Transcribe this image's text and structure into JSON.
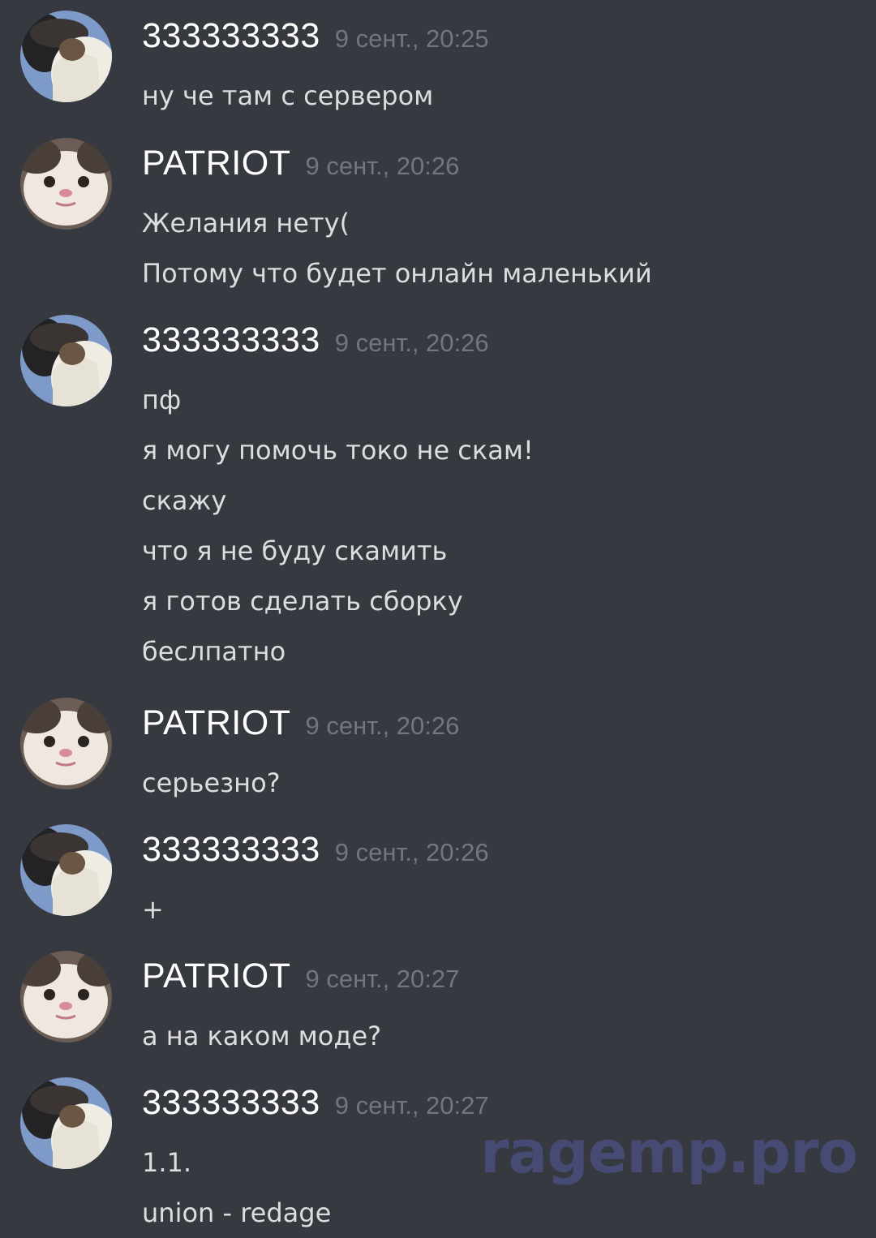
{
  "messages": [
    {
      "author": "333333333",
      "avatar": "hooded-avatar-icon",
      "time": "9 сент., 20:25",
      "lines": [
        "ну че там с сервером"
      ]
    },
    {
      "author": "PATRIOT",
      "avatar": "cat-avatar-icon",
      "time": "9 сент., 20:26",
      "lines": [
        "Желания нету(",
        "Потому что будет онлайн маленький"
      ]
    },
    {
      "author": "333333333",
      "avatar": "hooded-avatar-icon",
      "time": "9 сент., 20:26",
      "lines": [
        "пф",
        "я могу помочь токо не скам!",
        "скажу",
        "что я не буду скамить",
        "я готов сделать сборку",
        "беслпатно"
      ]
    },
    {
      "author": "PATRIOT",
      "avatar": "cat-avatar-icon",
      "time": "9 сент., 20:26",
      "lines": [
        "серьезно?"
      ]
    },
    {
      "author": "333333333",
      "avatar": "hooded-avatar-icon",
      "time": "9 сент., 20:26",
      "lines": [
        "+"
      ]
    },
    {
      "author": "PATRIOT",
      "avatar": "cat-avatar-icon",
      "time": "9 сент., 20:27",
      "lines": [
        "а на каком моде?"
      ]
    },
    {
      "author": "333333333",
      "avatar": "hooded-avatar-icon",
      "time": "9 сент., 20:27",
      "lines": [
        "1.1.",
        "union - redage"
      ]
    }
  ],
  "watermark": "ragemp.pro",
  "colors": {
    "background": "#36393f",
    "username": "#ffffff",
    "message_text": "#dcddde",
    "timestamp": "#72767d",
    "watermark": "#4a4e7c"
  }
}
